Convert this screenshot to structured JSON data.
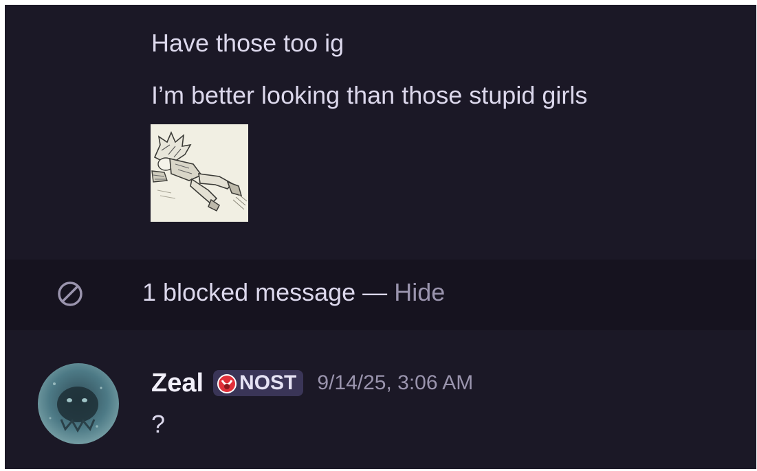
{
  "messages_above": {
    "line1": "Have those too ig",
    "line2": "I’m better looking than those stupid girls"
  },
  "attachment": {
    "icon": "manga-drawing-image"
  },
  "blocked": {
    "icon": "blocked-circle-icon",
    "text": "1 blocked message —",
    "hide_label": "Hide"
  },
  "message": {
    "username": "Zeal",
    "tag_icon": "nost-tag-icon",
    "tag_text": "NOST",
    "timestamp": "9/14/25, 3:06 AM",
    "body": "?"
  },
  "colors": {
    "background": "#1b1826",
    "blocked_row": "#16131f",
    "text": "#dcd8ec",
    "muted": "#9a94ad",
    "tag_bg": "#3a3557",
    "tag_icon_red": "#e0303a"
  }
}
